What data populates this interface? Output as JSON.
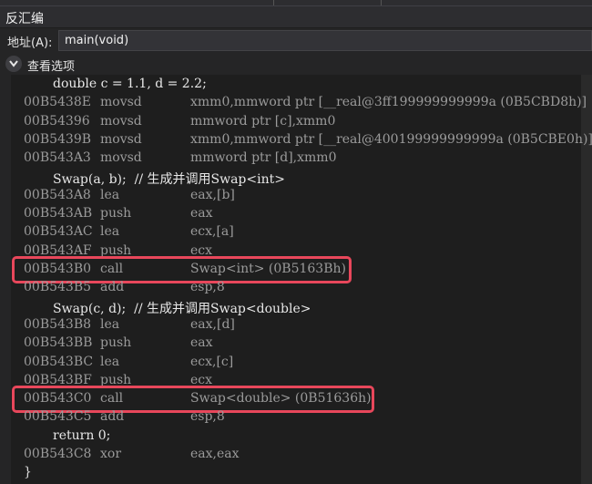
{
  "window": {
    "title": "反汇编"
  },
  "address_bar": {
    "label": "地址(A):",
    "value": "main(void)"
  },
  "view_options": {
    "label": "查看选项",
    "icon": "chevron-down-icon"
  },
  "lines": [
    {
      "type": "src",
      "text": "double c = 1.1, d = 2.2;"
    },
    {
      "type": "asm",
      "addr": "00B5438E",
      "mnemonic": "movsd",
      "operands": "xmm0,mmword ptr [__real@3ff199999999999a (0B5CBD8h)]"
    },
    {
      "type": "asm",
      "addr": "00B54396",
      "mnemonic": "movsd",
      "operands": "mmword ptr [c],xmm0"
    },
    {
      "type": "asm",
      "addr": "00B5439B",
      "mnemonic": "movsd",
      "operands": "xmm0,mmword ptr [__real@400199999999999a (0B5CBE0h)]"
    },
    {
      "type": "asm",
      "addr": "00B543A3",
      "mnemonic": "movsd",
      "operands": "mmword ptr [d],xmm0"
    },
    {
      "type": "src",
      "text": "Swap(a, b);  // 生成并调用Swap<int>"
    },
    {
      "type": "asm",
      "addr": "00B543A8",
      "mnemonic": "lea",
      "operands": "eax,[b]"
    },
    {
      "type": "asm",
      "addr": "00B543AB",
      "mnemonic": "push",
      "operands": "eax"
    },
    {
      "type": "asm",
      "addr": "00B543AC",
      "mnemonic": "lea",
      "operands": "ecx,[a]"
    },
    {
      "type": "asm",
      "addr": "00B543AF",
      "mnemonic": "push",
      "operands": "ecx"
    },
    {
      "type": "asm",
      "addr": "00B543B0",
      "mnemonic": "call",
      "operands": "Swap<int> (0B5163Bh)",
      "highlight": true
    },
    {
      "type": "asm",
      "addr": "00B543B5",
      "mnemonic": "add",
      "operands": "esp,8"
    },
    {
      "type": "src",
      "text": "Swap(c, d);  // 生成并调用Swap<double>"
    },
    {
      "type": "asm",
      "addr": "00B543B8",
      "mnemonic": "lea",
      "operands": "eax,[d]"
    },
    {
      "type": "asm",
      "addr": "00B543BB",
      "mnemonic": "push",
      "operands": "eax"
    },
    {
      "type": "asm",
      "addr": "00B543BC",
      "mnemonic": "lea",
      "operands": "ecx,[c]"
    },
    {
      "type": "asm",
      "addr": "00B543BF",
      "mnemonic": "push",
      "operands": "ecx"
    },
    {
      "type": "asm",
      "addr": "00B543C0",
      "mnemonic": "call",
      "operands": "Swap<double> (0B51636h)",
      "highlight": true
    },
    {
      "type": "asm",
      "addr": "00B543C5",
      "mnemonic": "add",
      "operands": "esp,8"
    },
    {
      "type": "src",
      "text": "return 0;"
    },
    {
      "type": "asm",
      "addr": "00B543C8",
      "mnemonic": "xor",
      "operands": "eax,eax"
    },
    {
      "type": "brace",
      "text": "}"
    }
  ],
  "colors": {
    "highlight_box": "#e8475b",
    "background": "#1e1e1e",
    "address_text": "#9b9b9b"
  }
}
